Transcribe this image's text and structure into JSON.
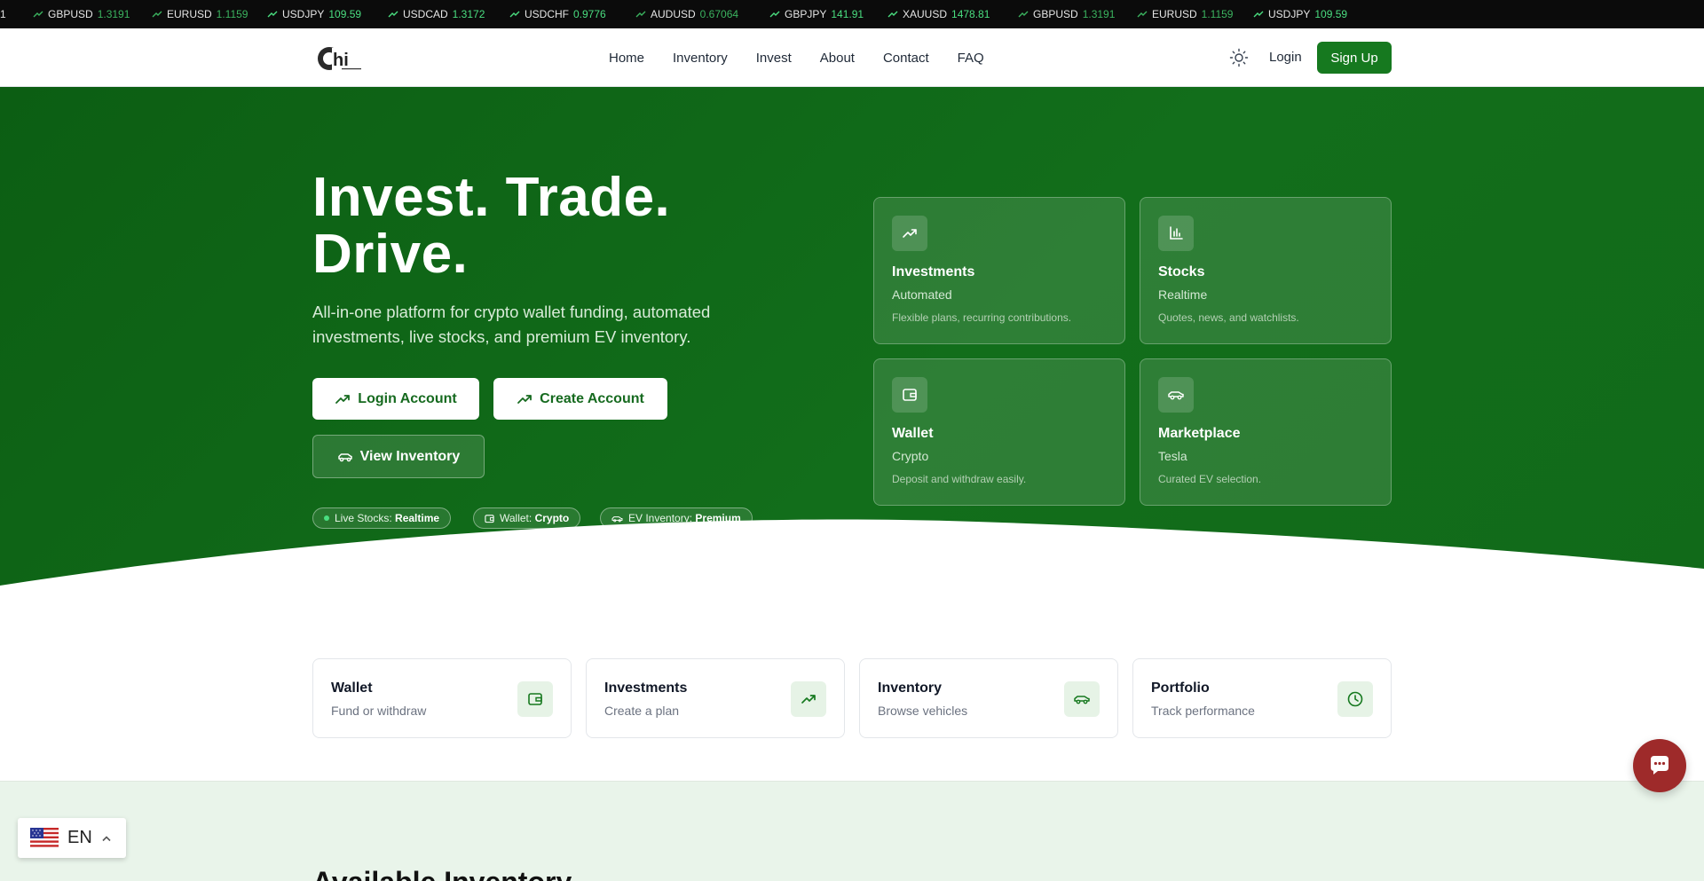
{
  "ticker": [
    {
      "symbol": "",
      "value": "1",
      "dir": "up"
    },
    {
      "symbol": "GBPUSD",
      "value": "1.3191",
      "dir": "down"
    },
    {
      "symbol": "EURUSD",
      "value": "1.1159",
      "dir": "down"
    },
    {
      "symbol": "USDJPY",
      "value": "109.59",
      "dir": "up"
    },
    {
      "symbol": "USDCAD",
      "value": "1.3172",
      "dir": "up"
    },
    {
      "symbol": "USDCHF",
      "value": "0.9776",
      "dir": "up"
    },
    {
      "symbol": "AUDUSD",
      "value": "0.67064",
      "dir": "down"
    },
    {
      "symbol": "GBPJPY",
      "value": "141.91",
      "dir": "up"
    },
    {
      "symbol": "XAUUSD",
      "value": "1478.81",
      "dir": "up"
    },
    {
      "symbol": "GBPUSD",
      "value": "1.3191",
      "dir": "down"
    },
    {
      "symbol": "EURUSD",
      "value": "1.1159",
      "dir": "down"
    },
    {
      "symbol": "USDJPY",
      "value": "109.59",
      "dir": "up"
    }
  ],
  "nav": {
    "links": [
      "Home",
      "Inventory",
      "Invest",
      "About",
      "Contact",
      "FAQ"
    ],
    "login": "Login",
    "signup": "Sign Up"
  },
  "hero": {
    "title_line1": "Invest. Trade.",
    "title_line2": "Drive.",
    "subtitle": "All-in-one platform for crypto wallet funding, automated investments, live stocks, and premium EV inventory.",
    "btn_login": "Login Account",
    "btn_create": "Create Account",
    "btn_inventory": "View Inventory",
    "badges": [
      {
        "label": "Live Stocks:",
        "value": "Realtime"
      },
      {
        "label": "Wallet:",
        "value": "Crypto"
      },
      {
        "label": "EV Inventory:",
        "value": "Premium"
      }
    ],
    "features": [
      {
        "title": "Investments",
        "sub": "Automated",
        "desc": "Flexible plans, recurring contributions.",
        "icon": "trending-up-icon"
      },
      {
        "title": "Stocks",
        "sub": "Realtime",
        "desc": "Quotes, news, and watchlists.",
        "icon": "bar-chart-icon"
      },
      {
        "title": "Wallet",
        "sub": "Crypto",
        "desc": "Deposit and withdraw easily.",
        "icon": "wallet-icon"
      },
      {
        "title": "Marketplace",
        "sub": "Tesla",
        "desc": "Curated EV selection.",
        "icon": "car-icon"
      }
    ]
  },
  "quick": [
    {
      "title": "Wallet",
      "sub": "Fund or withdraw",
      "icon": "wallet-icon"
    },
    {
      "title": "Investments",
      "sub": "Create a plan",
      "icon": "trending-up-icon"
    },
    {
      "title": "Inventory",
      "sub": "Browse vehicles",
      "icon": "car-icon"
    },
    {
      "title": "Portfolio",
      "sub": "Track performance",
      "icon": "clock-icon"
    }
  ],
  "inventory_heading": "Available Inventory",
  "language": "EN",
  "colors": {
    "brand": "#16791f",
    "hero": "#116a19",
    "chat": "#9e2a2a"
  }
}
